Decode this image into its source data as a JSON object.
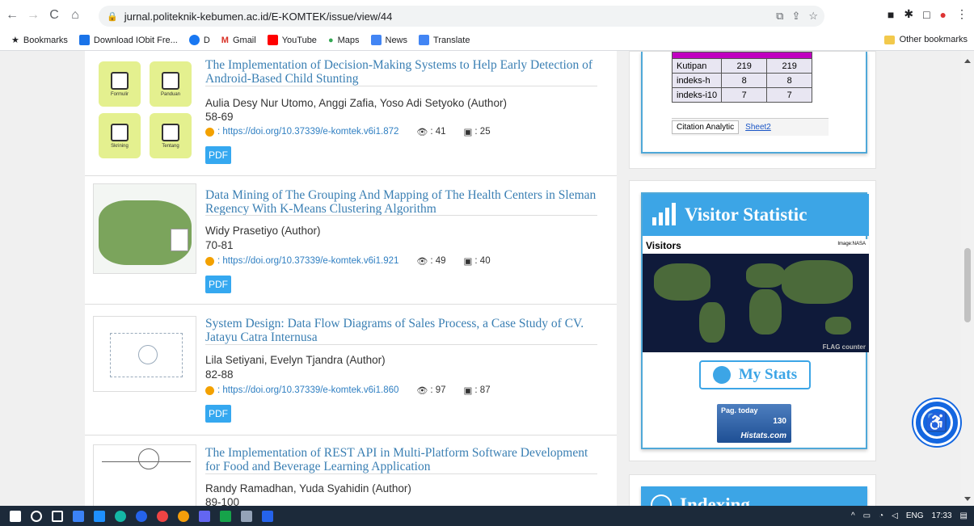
{
  "browser": {
    "url": "jurnal.politeknik-kebumen.ac.id/E-KOMTEK/issue/view/44",
    "bookmarks": [
      "Bookmarks",
      "Download IObit Fre...",
      "D",
      "Gmail",
      "YouTube",
      "Maps",
      "News",
      "Translate"
    ],
    "other_bookmarks": "Other bookmarks"
  },
  "articles": [
    {
      "title": "The Implementation of Decision-Making Systems to Help Early Detection of Android-Based Child Stunting",
      "authors": "Aulia Desy Nur Utomo, Anggi Zafia, Yoso Adi Setyoko (Author)",
      "pages": "58-69",
      "doi": ": https://doi.org/10.37339/e-komtek.v6i1.872",
      "views": ": 41",
      "downloads": ": 25",
      "pdf": "PDF",
      "thumb_tiles": [
        "Formulir",
        "Panduan",
        "Skrining",
        "Tentang"
      ]
    },
    {
      "title": "Data Mining of The Grouping And Mapping of The Health Centers in Sleman Regency With K-Means Clustering Algorithm",
      "authors": "Widy Prasetiyo (Author)",
      "pages": "70-81",
      "doi": ": https://doi.org/10.37339/e-komtek.v6i1.921",
      "views": ": 49",
      "downloads": ": 40",
      "pdf": "PDF"
    },
    {
      "title": "System Design: Data Flow Diagrams of Sales Process, a Case Study of CV. Jatayu Catra Internusa",
      "authors": "Lila Setiyani, Evelyn Tjandra (Author)",
      "pages": "82-88",
      "doi": ": https://doi.org/10.37339/e-komtek.v6i1.860",
      "views": ": 97",
      "downloads": ": 87",
      "pdf": "PDF"
    },
    {
      "title": "The Implementation of REST API in Multi-Platform Software Development for Food and Beverage Learning Application",
      "authors": "Randy Ramadhan, Yuda Syahidin (Author)",
      "pages": "89-100"
    }
  ],
  "citation_table": {
    "rows": [
      {
        "label": "Kutipan",
        "a": "219",
        "b": "219"
      },
      {
        "label": "indeks-h",
        "a": "8",
        "b": "8"
      },
      {
        "label": "indeks-i10",
        "a": "7",
        "b": "7"
      }
    ],
    "tabs": [
      "Citation Analytic",
      "Sheet2"
    ]
  },
  "visitor": {
    "title": "Visitor Statistic",
    "map_label": "Visitors",
    "map_credit": "Image:NASA",
    "flag_counter": "FLAG counter",
    "my_stats": "My Stats",
    "histats_label": "Pag. today",
    "histats_count": "130",
    "histats_brand": "Histats.com"
  },
  "indexing": {
    "title": "Indexing"
  },
  "taskbar": {
    "lang": "ENG",
    "time": "17:33"
  }
}
